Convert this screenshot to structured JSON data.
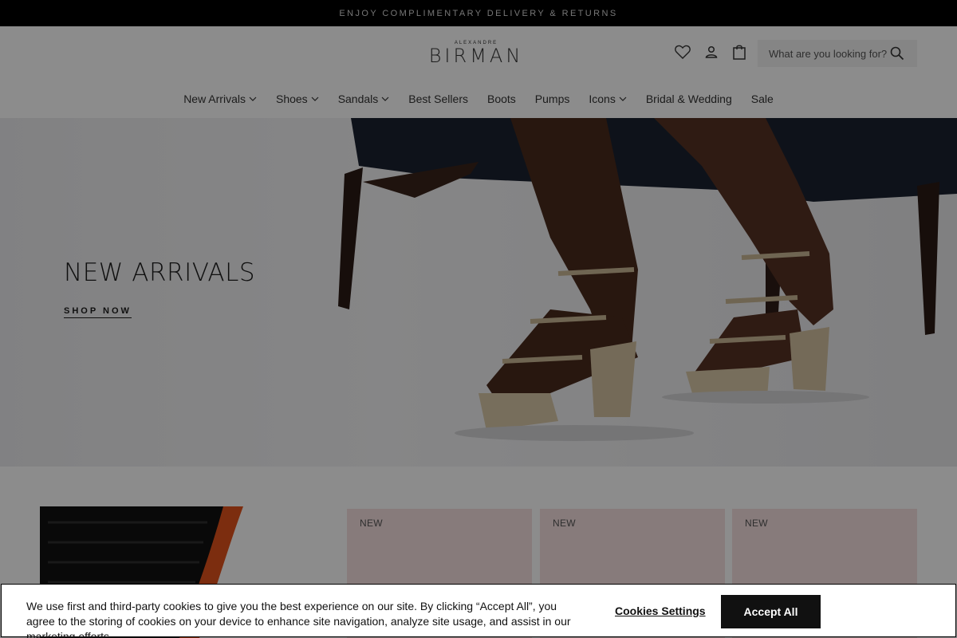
{
  "promo": {
    "text": "ENJOY COMPLIMENTARY DELIVERY & RETURNS"
  },
  "header": {
    "logo_small": "ALEXANDRE",
    "logo_big": "BIRMAN",
    "icons": [
      "heart-icon",
      "user-icon",
      "shopping-bag-icon",
      "search-icon"
    ],
    "search_placeholder": "What are you looking for?"
  },
  "nav": {
    "items": [
      {
        "label": "New Arrivals",
        "has_dropdown": true
      },
      {
        "label": "Shoes",
        "has_dropdown": true
      },
      {
        "label": "Sandals",
        "has_dropdown": true
      },
      {
        "label": "Best Sellers",
        "has_dropdown": false
      },
      {
        "label": "Boots",
        "has_dropdown": false
      },
      {
        "label": "Pumps",
        "has_dropdown": false
      },
      {
        "label": "Icons",
        "has_dropdown": true
      },
      {
        "label": "Bridal & Wedding",
        "has_dropdown": false
      },
      {
        "label": "Sale",
        "has_dropdown": false
      }
    ]
  },
  "hero": {
    "title": "NEW ARRIVALS",
    "cta": "SHOP NOW"
  },
  "products": {
    "cards": [
      {
        "badge": "NEW"
      },
      {
        "badge": "NEW"
      },
      {
        "badge": "NEW"
      }
    ]
  },
  "cookie": {
    "text": "We use first and third-party cookies to give you the best experience on our site. By clicking “Accept All”, you agree to the storing of cookies on your device to enhance site navigation, analyze site usage, and assist in our marketing efforts.",
    "settings_label": "Cookies Settings",
    "accept_label": "Accept All"
  },
  "colors": {
    "promo_bg": "#000000",
    "overlay": "rgba(0,0,0,0.45)",
    "card_bg": "#f6e1e1",
    "accept_bg": "#111111"
  }
}
